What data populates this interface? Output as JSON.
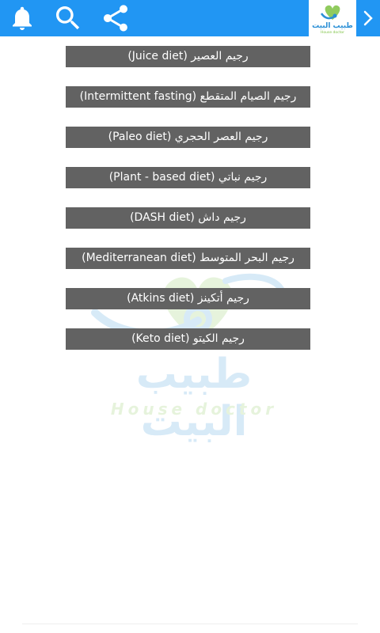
{
  "toolbar": {
    "background": "#2196f3",
    "icons": [
      "bell-icon",
      "search-icon",
      "share-icon",
      "chevron-right-icon"
    ]
  },
  "logo": {
    "arabic": "طبيب البيت",
    "english": "House doctor"
  },
  "menu": {
    "items": [
      {
        "label": "رجيم العصير (Juice diet)"
      },
      {
        "label": "رجيم الصيام المتقطع (Intermittent fasting)"
      },
      {
        "label": "رجيم العصر الحجري (Paleo diet)"
      },
      {
        "label": "رجيم نباتي (Plant - based diet)"
      },
      {
        "label": "رجيم داش (DASH diet)"
      },
      {
        "label": "رجيم البحر المتوسط (Mediterranean diet)"
      },
      {
        "label": "رجيم أتكينز (Atkins diet)"
      },
      {
        "label": "رجيم الكيتو (Keto diet)"
      }
    ]
  },
  "watermark": {
    "arabic": "طبيب البيت",
    "english": "House doctor"
  },
  "colors": {
    "button": "#626262",
    "button_text": "#ffffff",
    "logo_blue": "#2a8fd6",
    "logo_green": "#7cc242"
  }
}
